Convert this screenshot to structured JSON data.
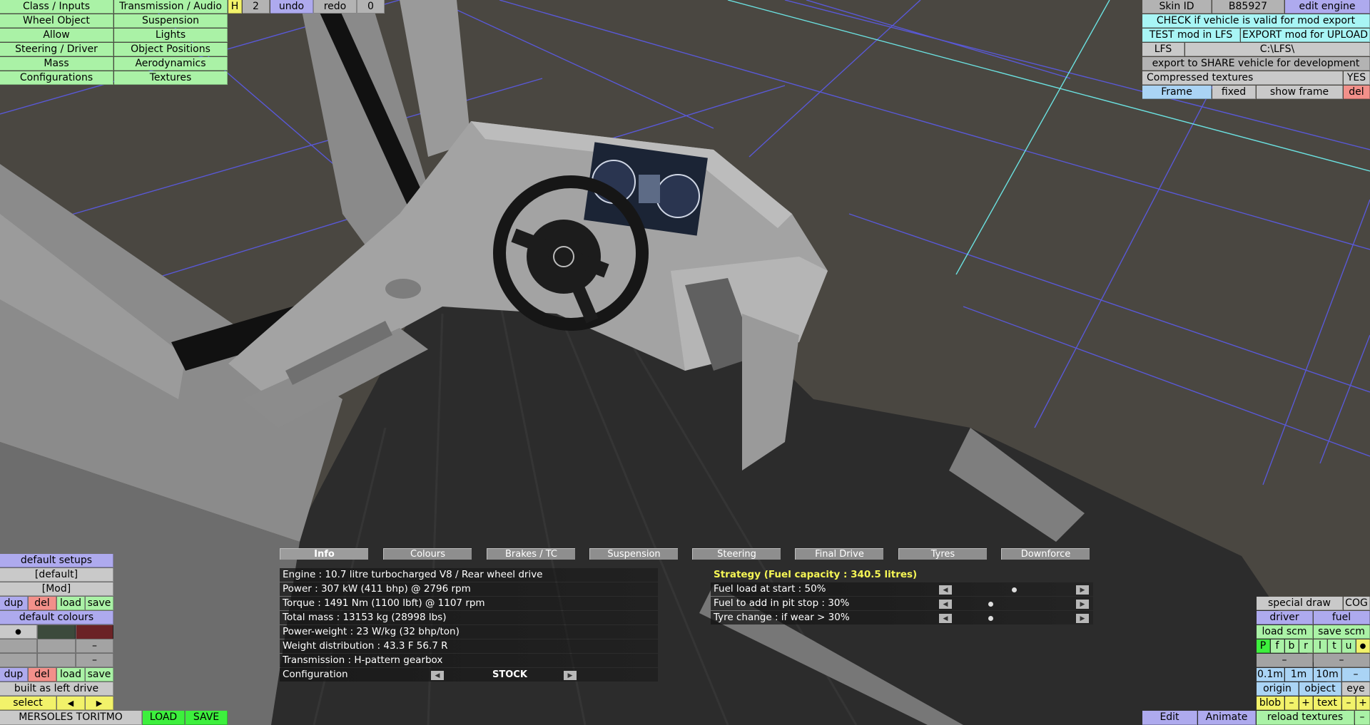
{
  "menu": {
    "class_inputs": "Class / Inputs",
    "transmission_audio": "Transmission / Audio",
    "wheel_object": "Wheel Object",
    "suspension": "Suspension",
    "allow": "Allow",
    "lights": "Lights",
    "steering_driver": "Steering / Driver",
    "object_positions": "Object Positions",
    "mass": "Mass",
    "aerodynamics": "Aerodynamics",
    "configurations": "Configurations",
    "textures": "Textures"
  },
  "history": {
    "h": "H",
    "count": "2",
    "undo": "undo",
    "redo": "redo",
    "redo_count": "0"
  },
  "top_right": {
    "skin_id_label": "Skin ID",
    "skin_id": "B85927",
    "edit_engine": "edit engine",
    "check_valid": "CHECK if vehicle is valid for mod export",
    "test_mod": "TEST mod in LFS",
    "export_mod": "EXPORT mod for UPLOAD",
    "lfs_label": "LFS",
    "lfs_path": "C:\\LFS\\",
    "export_share": "export to SHARE vehicle for development",
    "compressed_textures": "Compressed textures",
    "compressed_value": "YES",
    "frame": "Frame",
    "fixed": "fixed",
    "show_frame": "show frame",
    "del": "del"
  },
  "tabs": [
    "Info",
    "Colours",
    "Brakes / TC",
    "Suspension",
    "Steering",
    "Final Drive",
    "Tyres",
    "Downforce"
  ],
  "info": {
    "engine": "Engine : 10.7 litre turbocharged V8 / Rear wheel drive",
    "power": "Power : 307 kW (411 bhp) @ 2796 rpm",
    "torque": "Torque : 1491 Nm (1100 lbft) @ 1107 rpm",
    "total_mass": "Total mass : 13153 kg (28998 lbs)",
    "power_weight": "Power-weight : 23 W/kg (32 bhp/ton)",
    "weight_distribution": "Weight distribution : 43.3 F  56.7 R",
    "transmission": "Transmission : H-pattern gearbox",
    "configuration_label": "Configuration",
    "configuration_value": "STOCK"
  },
  "strategy": {
    "title": "Strategy (Fuel capacity : 340.5 litres)",
    "fuel_start": "Fuel load at start : 50%",
    "fuel_start_level": 0.5,
    "fuel_pit": "Fuel to add in pit stop : 30%",
    "fuel_pit_level": 0.3,
    "tyre_change": "Tyre change : if wear > 30%",
    "tyre_change_level": 0.3
  },
  "left_bottom": {
    "default_setups": "default setups",
    "default_setup": "[default]",
    "mod_setup": "[Mod]",
    "dup": "dup",
    "del": "del",
    "load": "load",
    "save": "save",
    "default_colours": "default colours",
    "dot": "●",
    "dash": "–",
    "built_as": "built as left drive",
    "select": "select",
    "prev": "◀",
    "next": "▶",
    "vehicle_name": "MERSOLES TORITMO",
    "load_btn": "LOAD",
    "save_btn": "SAVE"
  },
  "colours": {
    "swatch1": "#3c4a3c",
    "swatch2": "#6b2326"
  },
  "right_bottom": {
    "special_draw": "special draw",
    "cog": "COG",
    "driver": "driver",
    "fuel": "fuel",
    "load_scm": "load scm",
    "save_scm": "save scm",
    "letters": [
      "P",
      "f",
      "b",
      "r",
      "l",
      "t",
      "u"
    ],
    "dot": "●",
    "dash": "–",
    "d01": "0.1m",
    "d1": "1m",
    "d10": "10m",
    "dminus": "–",
    "origin": "origin",
    "object": "object",
    "eye": "eye",
    "blob": "blob",
    "minus": "–",
    "plus": "+",
    "text": "text",
    "edit": "Edit",
    "animate": "Animate",
    "reload_textures": "reload textures",
    "end_minus": "–"
  }
}
